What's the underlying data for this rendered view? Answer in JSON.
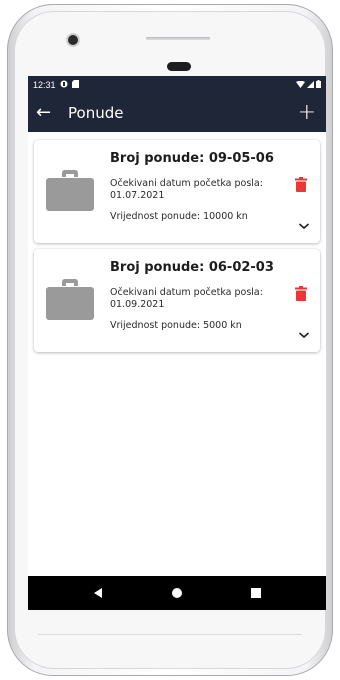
{
  "statusbar": {
    "time": "12:31"
  },
  "appbar": {
    "title": "Ponude",
    "back_icon": "←",
    "add_icon": "+"
  },
  "offers": [
    {
      "number": "Broj ponude: 09-05-06",
      "date": "Očekivani datum početka posla: 01.07.2021",
      "value": "Vrijednost ponude: 10000 kn"
    },
    {
      "number": "Broj ponude: 06-02-03",
      "date": "Očekivani datum početka posla: 01.09.2021",
      "value": "Vrijednost ponude: 5000 kn"
    }
  ],
  "colors": {
    "appbar": "#1f2638",
    "icon_gray": "#9a9a9a",
    "delete_red": "#e53935"
  }
}
